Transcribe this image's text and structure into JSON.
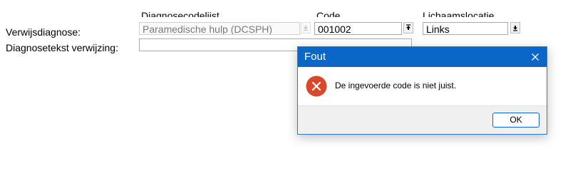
{
  "form": {
    "headers": {
      "diagnosecodelijst": "Diagnosecodelijst",
      "code": "Code",
      "lichaamslocatie": "Lichaamslocatie"
    },
    "verwijsdiagnose_label": "Verwijsdiagnose:",
    "diagnosetekst_label": "Diagnosetekst verwijzing:",
    "diagnosecodelijst_value": "Paramedische hulp (DCSPH)",
    "code_value": "001002",
    "lichaamslocatie_value": "Links",
    "diagnosetekst_value": ""
  },
  "dialog": {
    "title": "Fout",
    "message": "De ingevoerde code is niet juist.",
    "ok_label": "OK",
    "icon": "error-icon",
    "titlebar_color": "#0a67c8",
    "error_color": "#d9482b"
  }
}
